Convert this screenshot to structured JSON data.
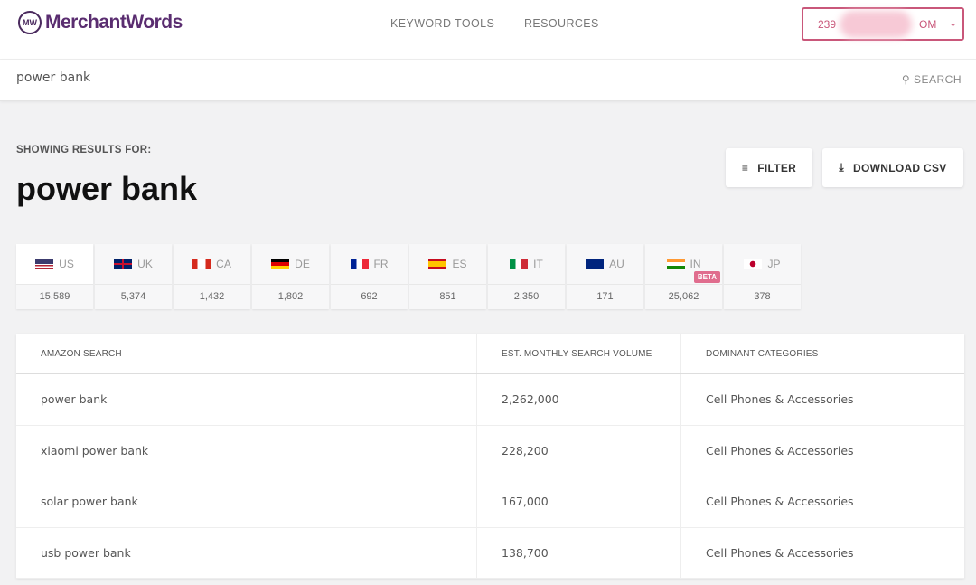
{
  "header": {
    "logo": "MerchantWords",
    "logo_mark": "MW",
    "nav": [
      "KEYWORD TOOLS",
      "RESOURCES"
    ],
    "account_prefix": "239",
    "account_suffix": "OM"
  },
  "search": {
    "value": "power bank",
    "button": "SEARCH"
  },
  "results": {
    "showing_label": "SHOWING RESULTS FOR:",
    "query": "power bank",
    "filter": "FILTER",
    "download": "DOWNLOAD CSV"
  },
  "countries": [
    {
      "code": "US",
      "count": "15,589",
      "active": true
    },
    {
      "code": "UK",
      "count": "5,374"
    },
    {
      "code": "CA",
      "count": "1,432"
    },
    {
      "code": "DE",
      "count": "1,802"
    },
    {
      "code": "FR",
      "count": "692"
    },
    {
      "code": "ES",
      "count": "851"
    },
    {
      "code": "IT",
      "count": "2,350"
    },
    {
      "code": "AU",
      "count": "171"
    },
    {
      "code": "IN",
      "count": "25,062",
      "badge": "BETA"
    },
    {
      "code": "JP",
      "count": "378"
    }
  ],
  "table": {
    "headers": [
      "AMAZON SEARCH",
      "EST. MONTHLY SEARCH VOLUME",
      "DOMINANT CATEGORIES"
    ],
    "rows": [
      [
        "power bank",
        "2,262,000",
        "Cell Phones & Accessories"
      ],
      [
        "xiaomi power bank",
        "228,200",
        "Cell Phones & Accessories"
      ],
      [
        "solar power bank",
        "167,000",
        "Cell Phones & Accessories"
      ],
      [
        "usb power bank",
        "138,700",
        "Cell Phones & Accessories"
      ]
    ]
  },
  "colors": {
    "brand": "#5a2d70",
    "accent": "#c9577a",
    "beta": "#e06d8e"
  }
}
